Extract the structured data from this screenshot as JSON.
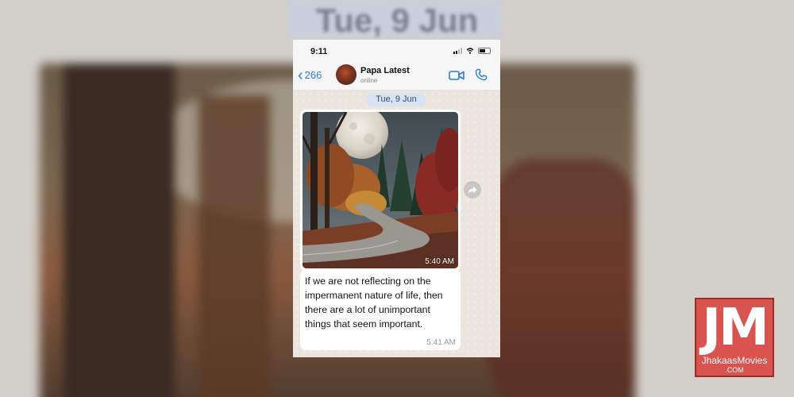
{
  "background": {
    "date_text": "Tue, 9 Jun"
  },
  "status_bar": {
    "time": "9:11"
  },
  "header": {
    "back_count": "266",
    "contact_name": "Papa Latest",
    "contact_status": "online",
    "accent_color": "#2c7be5"
  },
  "chat": {
    "date_pill": "Tue, 9 Jun",
    "messages": [
      {
        "type": "image",
        "time": "5:40 AM"
      },
      {
        "type": "text",
        "text": "If we are not reflecting on the impermanent nature of life, then there are a lot of unimportant things that seem important.",
        "time": "5:41 AM"
      }
    ]
  },
  "icons": {
    "back": "chevron-left-icon",
    "video": "video-camera-icon",
    "call": "phone-icon",
    "forward": "forward-icon"
  },
  "watermark": {
    "letters": "JM",
    "name": "JhakaasMovies",
    "domain": ".COM"
  }
}
